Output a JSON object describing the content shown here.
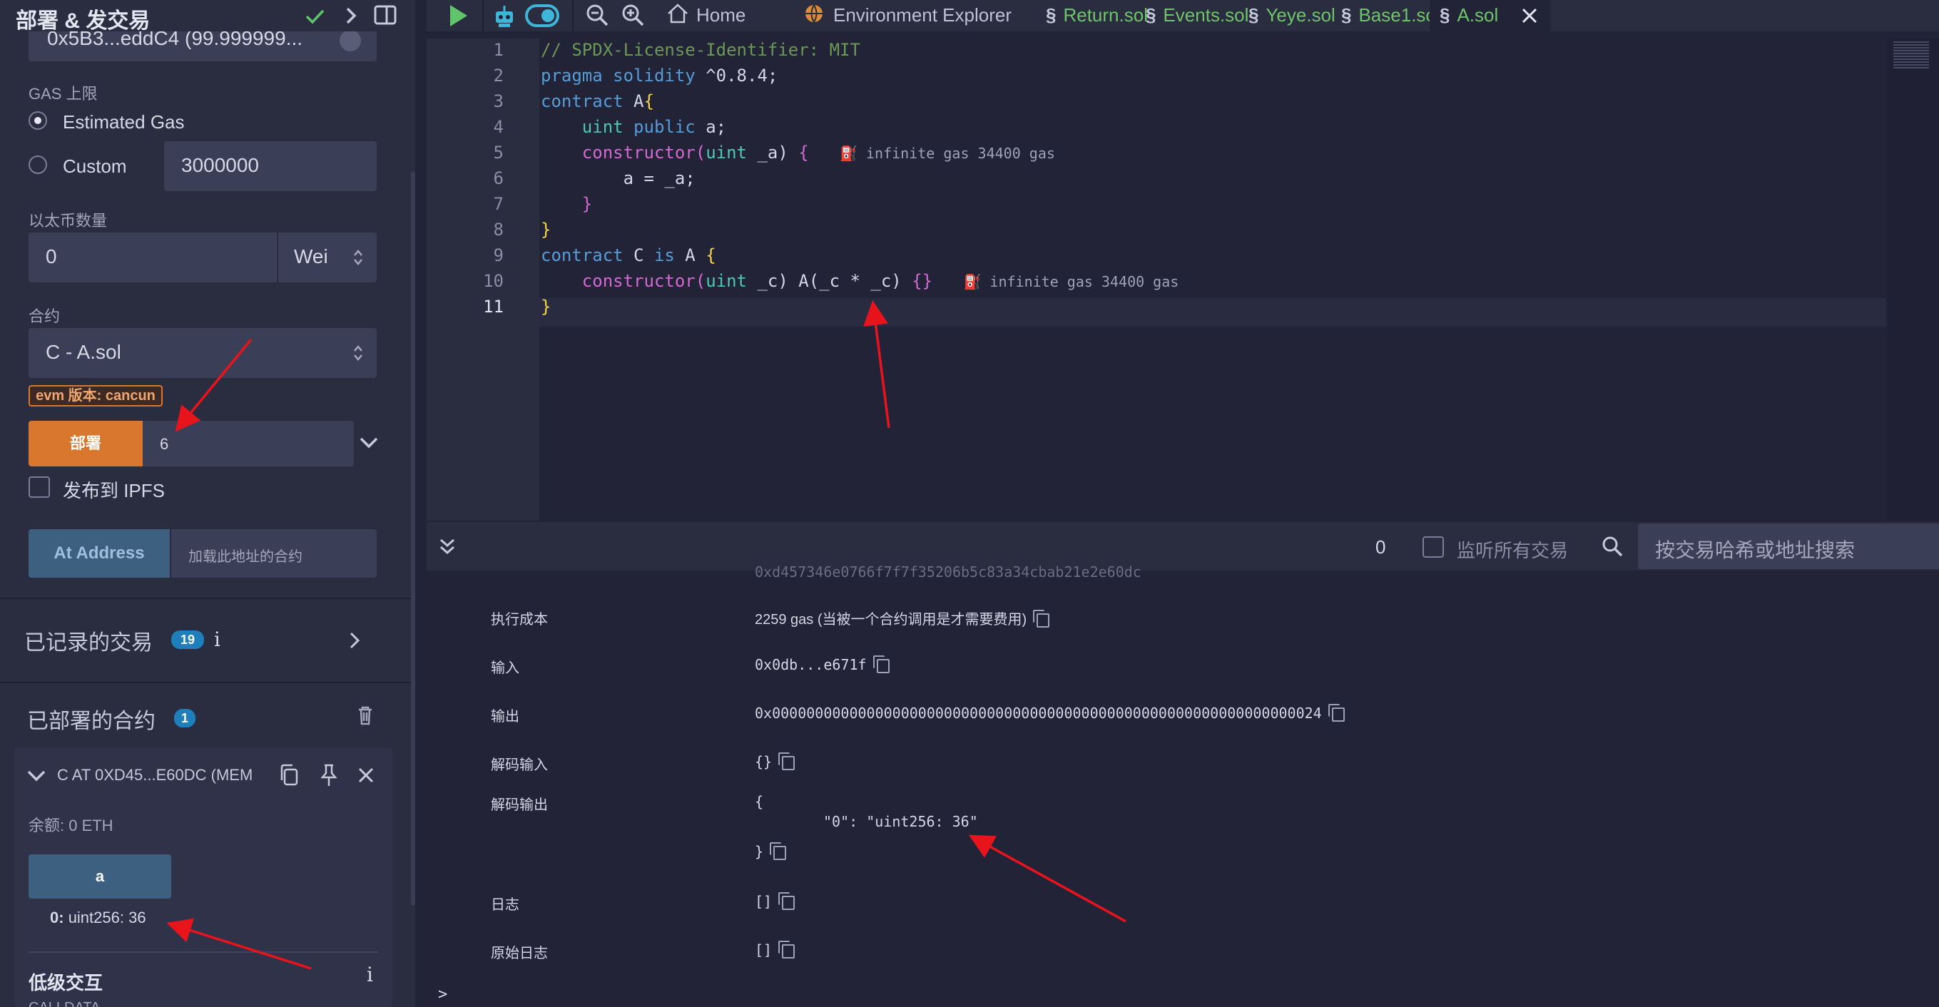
{
  "left": {
    "title": "部署 & 发交易",
    "account_value": "0x5B3...eddC4 (99.999999...",
    "gas_limit_label": "GAS 上限",
    "estimated_gas_label": "Estimated Gas",
    "custom_label": "Custom",
    "custom_gas_value": "3000000",
    "value_label": "以太币数量",
    "value_amount": "0",
    "value_unit": "Wei",
    "contract_label": "合约",
    "contract_selected": "C - A.sol",
    "evm_badge": "evm 版本: cancun",
    "deploy_button": "部署",
    "deploy_arg": "6",
    "publish_ipfs_label": "发布到 IPFS",
    "at_address_button": "At Address",
    "at_address_placeholder": "加载此地址的合约",
    "recorded_tx_label": "已记录的交易",
    "recorded_tx_count": "19",
    "deployed_label": "已部署的合约",
    "deployed_count": "1",
    "instance_name": "C AT 0XD45...E60DC (MEM",
    "balance_label": "余额: 0 ETH",
    "fn_button": "a",
    "fn_result_key": "0:",
    "fn_result_value": "uint256: 36",
    "low_level_label": "低级交互",
    "calldata_label": "CALLDATA"
  },
  "tabs": [
    {
      "label": "Home"
    },
    {
      "label": "Environment Explorer"
    },
    {
      "label": "Return.sol"
    },
    {
      "label": "Events.sol"
    },
    {
      "label": "Yeye.sol"
    },
    {
      "label": "Base1.sol"
    },
    {
      "label": "A.sol"
    }
  ],
  "code": {
    "line_numbers": [
      "1",
      "2",
      "3",
      "4",
      "5",
      "6",
      "7",
      "8",
      "9",
      "10",
      "11"
    ],
    "l1": "// SPDX-License-Identifier: MIT",
    "l2_kw": "pragma solidity",
    "l2_rest": " ^0.8.4;",
    "l3_kw": "contract",
    "l3_name": " A",
    "l4_ty": "uint",
    "l4_kw": " public",
    "l4_rest": " a;",
    "l5_fn": "constructor",
    "l5_open": "(",
    "l5_ty": "uint",
    "l5_rest": " _a) ",
    "l6": "a = _a;",
    "l9_kw": "contract",
    "l9_name": " C ",
    "l9_is": "is",
    "l9_rest": " A ",
    "l10_fn": "constructor",
    "l10_open": "(",
    "l10_ty": "uint",
    "l10_rest": " _c) A(_c * _c) ",
    "gas_hint": "infinite gas 34400 gas"
  },
  "terminal": {
    "tx_count": "0",
    "listen_label": "监听所有交易",
    "search_placeholder": "按交易哈希或地址搜索",
    "rows": {
      "cost_key": "执行成本",
      "cost_val": "2259 gas (当被一个合约调用是才需要费用)",
      "input_key": "输入",
      "input_val": "0x0db...e671f",
      "output_key": "输出",
      "output_val": "0x0000000000000000000000000000000000000000000000000000000000000024",
      "decoded_input_key": "解码输入",
      "decoded_input_val": "{}",
      "decoded_output_key": "解码输出",
      "decoded_output_open": "{",
      "decoded_output_line": "\"0\": \"uint256: 36\"",
      "decoded_output_close": "}",
      "logs_key": "日志",
      "logs_val": "[]",
      "raw_logs_key": "原始日志",
      "raw_logs_val": "[]",
      "partial_val": "0xd457346e0766f7f7f35206b5c83a34cbab21e2e60dc"
    },
    "prompt": ">"
  },
  "colors": {
    "accent_orange": "#d9772e",
    "at_address_blue": "#3d6080",
    "badge_blue": "#1f7fba",
    "arrow_red": "#e8141c"
  }
}
